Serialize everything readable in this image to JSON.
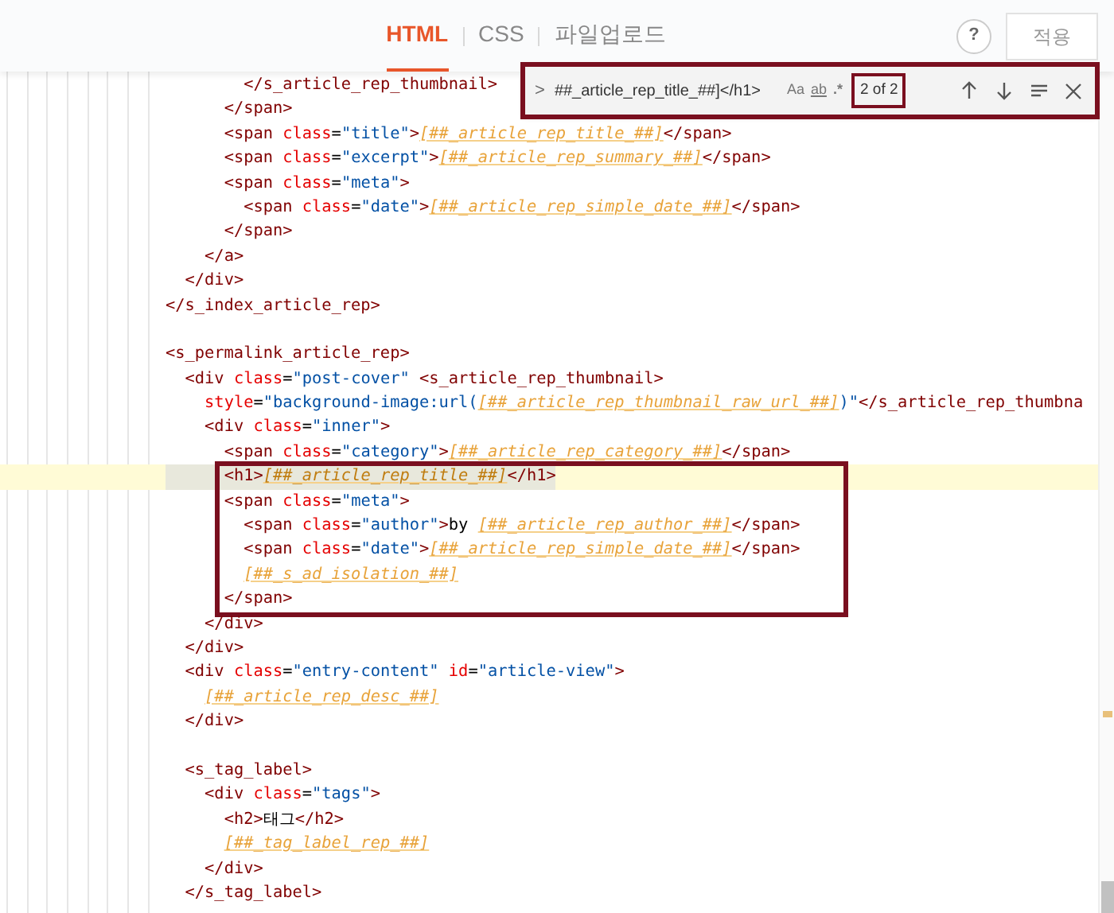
{
  "header": {
    "tabs": [
      {
        "label": "HTML",
        "selected": true
      },
      {
        "label": "CSS",
        "selected": false
      },
      {
        "label": "파일업로드",
        "selected": false
      }
    ],
    "help_button": "?",
    "apply_button": "적용"
  },
  "find_widget": {
    "framed": true,
    "toggle": ">",
    "query": "##_article_rep_title_##]</h1>",
    "options": [
      "Aa",
      "ab",
      ".*"
    ],
    "match_count": "2 of 2",
    "count_framed": true
  },
  "code_lines": [
    {
      "segments": [
        {
          "kind": "tag",
          "text": "        </s_article_rep_thumbnail>"
        }
      ]
    },
    {
      "segments": [
        {
          "kind": "tag",
          "text": "      </span>"
        }
      ]
    },
    {
      "segments": [
        {
          "kind": "tag",
          "text": "      <span "
        },
        {
          "kind": "attr",
          "text": "class"
        },
        {
          "kind": "text",
          "text": "="
        },
        {
          "kind": "str",
          "text": "\"title\""
        },
        {
          "kind": "tag",
          "text": ">"
        },
        {
          "kind": "var",
          "text": "[##_article_rep_title_##]"
        },
        {
          "kind": "tag",
          "text": "</span>"
        }
      ]
    },
    {
      "segments": [
        {
          "kind": "tag",
          "text": "      <span "
        },
        {
          "kind": "attr",
          "text": "class"
        },
        {
          "kind": "text",
          "text": "="
        },
        {
          "kind": "str",
          "text": "\"excerpt\""
        },
        {
          "kind": "tag",
          "text": ">"
        },
        {
          "kind": "var",
          "text": "[##_article_rep_summary_##]"
        },
        {
          "kind": "tag",
          "text": "</span>"
        }
      ]
    },
    {
      "segments": [
        {
          "kind": "tag",
          "text": "      <span "
        },
        {
          "kind": "attr",
          "text": "class"
        },
        {
          "kind": "text",
          "text": "="
        },
        {
          "kind": "str",
          "text": "\"meta\""
        },
        {
          "kind": "tag",
          "text": ">"
        }
      ]
    },
    {
      "segments": [
        {
          "kind": "tag",
          "text": "        <span "
        },
        {
          "kind": "attr",
          "text": "class"
        },
        {
          "kind": "text",
          "text": "="
        },
        {
          "kind": "str",
          "text": "\"date\""
        },
        {
          "kind": "tag",
          "text": ">"
        },
        {
          "kind": "var",
          "text": "[##_article_rep_simple_date_##]"
        },
        {
          "kind": "tag",
          "text": "</span>"
        }
      ]
    },
    {
      "segments": [
        {
          "kind": "tag",
          "text": "      </span>"
        }
      ]
    },
    {
      "segments": [
        {
          "kind": "tag",
          "text": "    </a>"
        }
      ]
    },
    {
      "segments": [
        {
          "kind": "tag",
          "text": "  </div>"
        }
      ]
    },
    {
      "segments": [
        {
          "kind": "tag",
          "text": "</s_index_article_rep>"
        }
      ]
    },
    {
      "blank": true
    },
    {
      "segments": [
        {
          "kind": "tag",
          "text": "<s_permalink_article_rep>"
        }
      ]
    },
    {
      "segments": [
        {
          "kind": "tag",
          "text": "  <div "
        },
        {
          "kind": "attr",
          "text": "class"
        },
        {
          "kind": "text",
          "text": "="
        },
        {
          "kind": "str",
          "text": "\"post-cover\""
        },
        {
          "kind": "tag",
          "text": " <s_article_rep_thumbnail>"
        }
      ]
    },
    {
      "segments": [
        {
          "kind": "attr",
          "text": "    style"
        },
        {
          "kind": "text",
          "text": "="
        },
        {
          "kind": "str",
          "text": "\"background-image:url("
        },
        {
          "kind": "var",
          "text": "[##_article_rep_thumbnail_raw_url_##]"
        },
        {
          "kind": "str",
          "text": ")\""
        },
        {
          "kind": "tag",
          "text": "</s_article_rep_thumbna"
        }
      ]
    },
    {
      "segments": [
        {
          "kind": "tag",
          "text": "    <div "
        },
        {
          "kind": "attr",
          "text": "class"
        },
        {
          "kind": "text",
          "text": "="
        },
        {
          "kind": "str",
          "text": "\"inner\""
        },
        {
          "kind": "tag",
          "text": ">"
        }
      ]
    },
    {
      "segments": [
        {
          "kind": "tag",
          "text": "      <span "
        },
        {
          "kind": "attr",
          "text": "class"
        },
        {
          "kind": "text",
          "text": "="
        },
        {
          "kind": "str",
          "text": "\"category\""
        },
        {
          "kind": "tag",
          "text": ">"
        },
        {
          "kind": "var",
          "text": "[##_article_rep_category_##]"
        },
        {
          "kind": "tag",
          "text": "</span>"
        }
      ]
    },
    {
      "current_match": true,
      "boxed": true,
      "segments": [
        {
          "kind": "tag",
          "text": "      <h1>"
        },
        {
          "kind": "var",
          "text": "[##_article_rep_title_##]"
        },
        {
          "kind": "tag",
          "text": "</h1>"
        }
      ]
    },
    {
      "boxed": true,
      "segments": [
        {
          "kind": "tag",
          "text": "      <span "
        },
        {
          "kind": "attr",
          "text": "class"
        },
        {
          "kind": "text",
          "text": "="
        },
        {
          "kind": "str",
          "text": "\"meta\""
        },
        {
          "kind": "tag",
          "text": ">"
        }
      ]
    },
    {
      "boxed": true,
      "segments": [
        {
          "kind": "tag",
          "text": "        <span "
        },
        {
          "kind": "attr",
          "text": "class"
        },
        {
          "kind": "text",
          "text": "="
        },
        {
          "kind": "str",
          "text": "\"author\""
        },
        {
          "kind": "tag",
          "text": ">"
        },
        {
          "kind": "text",
          "text": "by "
        },
        {
          "kind": "var",
          "text": "[##_article_rep_author_##]"
        },
        {
          "kind": "tag",
          "text": "</span>"
        }
      ]
    },
    {
      "boxed": true,
      "segments": [
        {
          "kind": "tag",
          "text": "        <span "
        },
        {
          "kind": "attr",
          "text": "class"
        },
        {
          "kind": "text",
          "text": "="
        },
        {
          "kind": "str",
          "text": "\"date\""
        },
        {
          "kind": "tag",
          "text": ">"
        },
        {
          "kind": "var",
          "text": "[##_article_rep_simple_date_##]"
        },
        {
          "kind": "tag",
          "text": "</span>"
        }
      ]
    },
    {
      "boxed": true,
      "segments": [
        {
          "kind": "var",
          "text": "        [##_s_ad_isolation_##]"
        }
      ]
    },
    {
      "boxed": true,
      "segments": [
        {
          "kind": "tag",
          "text": "      </span>"
        }
      ]
    },
    {
      "segments": [
        {
          "kind": "tag",
          "text": "    </div>"
        }
      ]
    },
    {
      "segments": [
        {
          "kind": "tag",
          "text": "  </div>"
        }
      ]
    },
    {
      "segments": [
        {
          "kind": "tag",
          "text": "  <div "
        },
        {
          "kind": "attr",
          "text": "class"
        },
        {
          "kind": "text",
          "text": "="
        },
        {
          "kind": "str",
          "text": "\"entry-content\""
        },
        {
          "kind": "attr",
          "text": " id"
        },
        {
          "kind": "text",
          "text": "="
        },
        {
          "kind": "str",
          "text": "\"article-view\""
        },
        {
          "kind": "tag",
          "text": ">"
        }
      ]
    },
    {
      "segments": [
        {
          "kind": "var",
          "text": "    [##_article_rep_desc_##]"
        }
      ]
    },
    {
      "segments": [
        {
          "kind": "tag",
          "text": "  </div>"
        }
      ]
    },
    {
      "blank": true
    },
    {
      "segments": [
        {
          "kind": "tag",
          "text": "  <s_tag_label>"
        }
      ]
    },
    {
      "segments": [
        {
          "kind": "tag",
          "text": "    <div "
        },
        {
          "kind": "attr",
          "text": "class"
        },
        {
          "kind": "text",
          "text": "="
        },
        {
          "kind": "str",
          "text": "\"tags\""
        },
        {
          "kind": "tag",
          "text": ">"
        }
      ]
    },
    {
      "segments": [
        {
          "kind": "tag",
          "text": "      <h2>"
        },
        {
          "kind": "text",
          "text": "태그"
        },
        {
          "kind": "tag",
          "text": "</h2>"
        }
      ]
    },
    {
      "segments": [
        {
          "kind": "var",
          "text": "      [##_tag_label_rep_##]"
        }
      ]
    },
    {
      "segments": [
        {
          "kind": "tag",
          "text": "    </div>"
        }
      ]
    },
    {
      "segments": [
        {
          "kind": "tag",
          "text": "  </s_tag_label>"
        }
      ]
    }
  ]
}
